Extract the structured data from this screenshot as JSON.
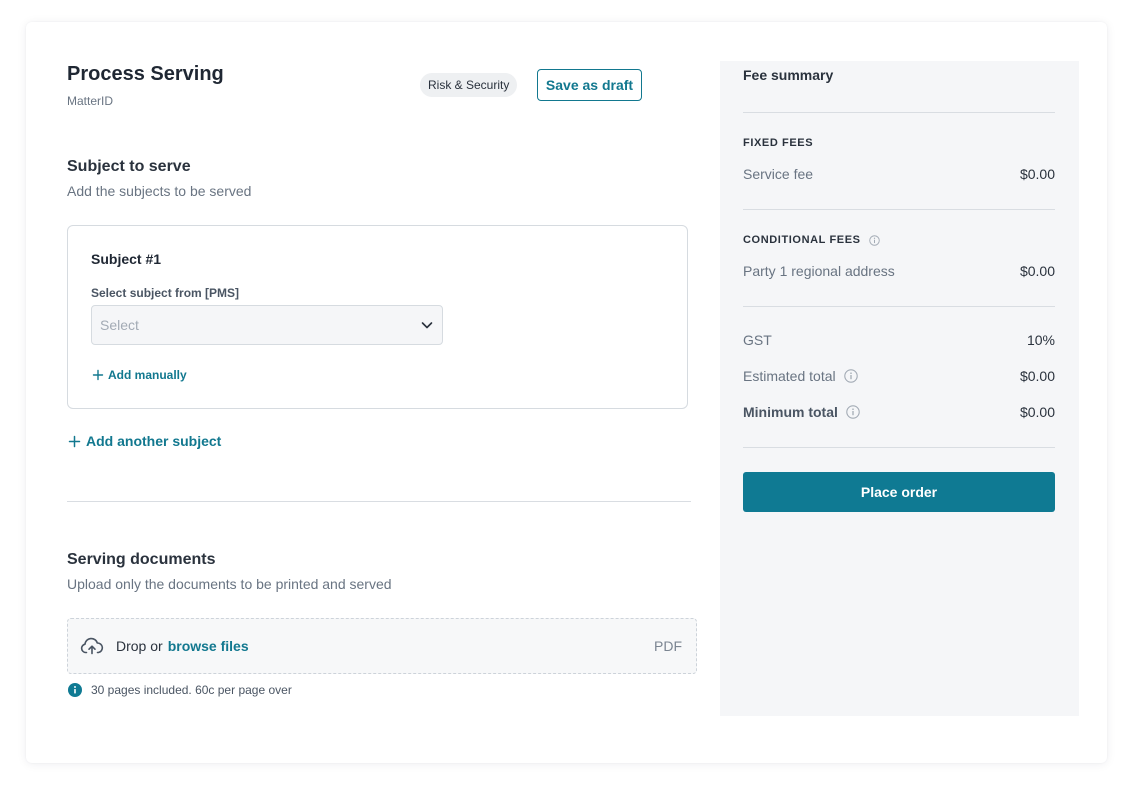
{
  "header": {
    "title": "Process Serving",
    "subtitle": "MatterID",
    "tag": "Risk & Security",
    "save_draft_label": "Save as draft"
  },
  "subjects_section": {
    "title": "Subject to serve",
    "description": "Add the subjects to be served",
    "subject": {
      "title": "Subject #1",
      "field_label": "Select subject from [PMS]",
      "select_placeholder": "Select",
      "add_manual_label": "Add manually"
    },
    "add_another_label": "Add another subject"
  },
  "documents_section": {
    "title": "Serving documents",
    "description": "Upload only the documents to be printed and served",
    "dropzone": {
      "text": "Drop or",
      "link": "browse files",
      "file_type": "PDF"
    },
    "info": "30 pages included. 60c per page over"
  },
  "fee_summary": {
    "title": "Fee summary",
    "fixed_heading": "FIXED FEES",
    "fixed_rows": [
      {
        "label": "Service fee",
        "amount": "$0.00"
      }
    ],
    "conditional_heading": "CONDITIONAL FEES",
    "conditional_rows": [
      {
        "label": "Party 1 regional address",
        "amount": "$0.00"
      }
    ],
    "gst": {
      "label": "GST",
      "value": "10%"
    },
    "estimated_total": {
      "label": "Estimated total",
      "amount": "$0.00"
    },
    "minimum_total": {
      "label": "Minimum total",
      "amount": "$0.00"
    },
    "place_order_label": "Place order"
  },
  "colors": {
    "accent": "#12788f",
    "primary_button": "#0f7a93",
    "panel_bg": "#f5f6f8"
  }
}
